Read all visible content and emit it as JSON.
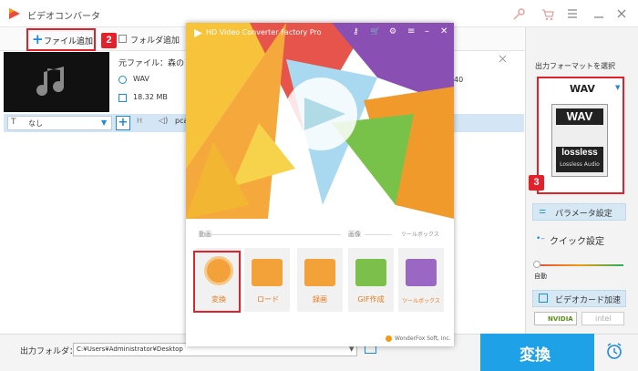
{
  "window": {
    "title": "ビデオコンバータ"
  },
  "toolbar": {
    "add_file": "ファイル追加",
    "add_folder": "フォルダ追加"
  },
  "file": {
    "name_label": "元ファイル：森の",
    "format": "WAV",
    "size": "18.32 MB",
    "duration_partial": "40"
  },
  "subbar": {
    "subtitle_value": "なし",
    "audio_label": "pca"
  },
  "popup": {
    "title": "HD Video Converter Factory Pro",
    "section_video": "動画",
    "section_image": "画像",
    "section_toolbox": "ツールボックス",
    "tiles": [
      "変換",
      "ダウンロード",
      "録画",
      "GIF作成",
      "ツールボックス"
    ],
    "tile_download_visible": "ロード",
    "footer": "WonderFox Soft, Inc."
  },
  "right": {
    "format_heading": "出力フォーマットを選択",
    "format_value": "WAV",
    "format_icon_text": "WAV",
    "lossless_text": "lossless",
    "lossless_sub": "Lossless Audio",
    "param_button": "パラメータ設定",
    "quick_label": "クイック設定",
    "auto_label": "自動",
    "gpu_button": "ビデオカード加速",
    "nvidia": "NVIDIA",
    "intel": "intel"
  },
  "bottom": {
    "folder_label": "出力フォルダ：",
    "folder_path": "C:¥Users¥Administrator¥Desktop",
    "convert_button": "変換"
  },
  "badges": [
    "1",
    "2",
    "3"
  ],
  "colors": {
    "accent": "#1fa1e8",
    "red": "#e3212b",
    "orange": "#e47a1f",
    "popup_yellow": "#f7c33b"
  }
}
